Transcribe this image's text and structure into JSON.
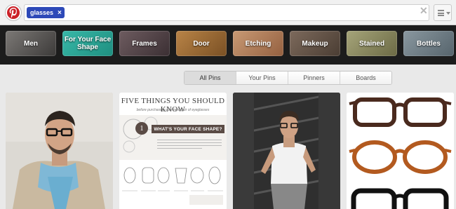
{
  "header": {
    "logo_icon": "pinterest-logo-icon",
    "search_token": "glasses",
    "token_remove_icon": "close-icon",
    "clear_icon": "close-icon",
    "menu_icon": "menu-icon"
  },
  "categories": [
    {
      "label": "Men",
      "color": "#5c5a58"
    },
    {
      "label": "For Your Face Shape",
      "color": "#2aa293"
    },
    {
      "label": "Frames",
      "color": "#5a4a4e"
    },
    {
      "label": "Door",
      "color": "#9a6a3a"
    },
    {
      "label": "Etching",
      "color": "#b07e5a"
    },
    {
      "label": "Makeup",
      "color": "#6b5a4d"
    },
    {
      "label": "Stained",
      "color": "#8a8a62"
    },
    {
      "label": "Bottles",
      "color": "#6c7a82"
    }
  ],
  "filter_tabs": [
    {
      "label": "All Pins",
      "active": true
    },
    {
      "label": "Your Pins",
      "active": false
    },
    {
      "label": "Pinners",
      "active": false
    },
    {
      "label": "Boards",
      "active": false
    }
  ],
  "pins": {
    "infographic": {
      "title": "FIVE THINGS YOU SHOULD KNOW",
      "subtitle": "before purchasing your next pair of eyeglasses",
      "step_number": "1",
      "section_title": "WHAT'S YOUR FACE SHAPE?"
    }
  },
  "colors": {
    "brand_red": "#cb2027",
    "token_blue": "#2d49b8",
    "strip_dark": "#1c1c1c"
  }
}
